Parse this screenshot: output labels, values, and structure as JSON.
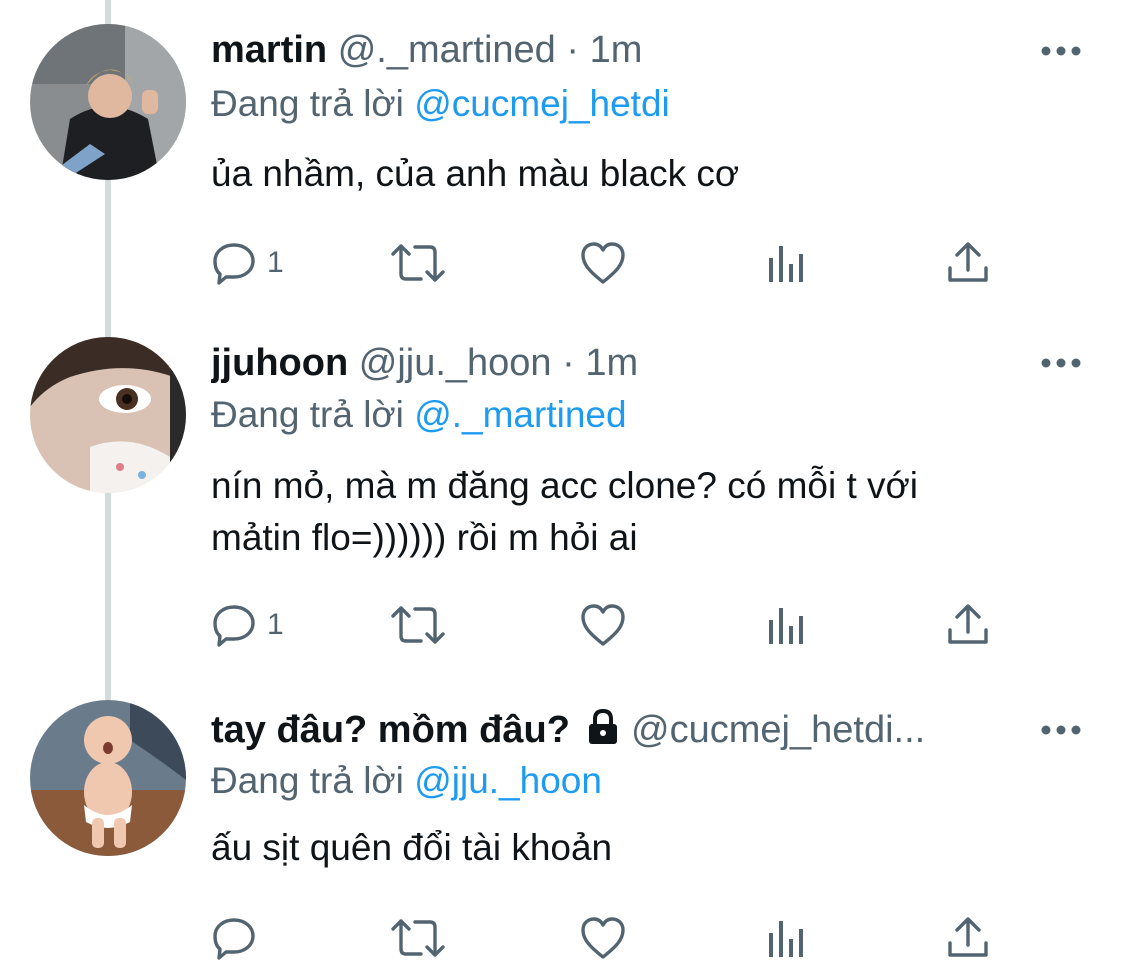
{
  "tweets": [
    {
      "name": "martin",
      "handle": "@._martined",
      "separator": "·",
      "time": "1m",
      "replying_prefix": "Đang trả lời",
      "replying_to": "@cucmej_hetdi",
      "text": "ủa nhầm, của anh màu black cơ",
      "reply_count": "1",
      "locked": false
    },
    {
      "name": "jjuhoon",
      "handle": "@jju._hoon",
      "separator": "·",
      "time": "1m",
      "replying_prefix": "Đang trả lời",
      "replying_to": "@._martined",
      "text_line1": "nín mỏ, mà m đăng acc clone? có mỗi t với",
      "text_line2": "mảtin flo=)))))) rồi m hỏi ai",
      "reply_count": "1",
      "locked": false
    },
    {
      "name": "tay đâu? mồm đâu?",
      "handle": "@cucmej_hetdi...",
      "replying_prefix": "Đang trả lời",
      "replying_to": "@jju._hoon",
      "text": "ấu sịt quên đổi tài khoản",
      "reply_count": "",
      "locked": true
    }
  ],
  "icons": {
    "reply": "speech-bubble",
    "retweet": "retweet-arrows",
    "like": "heart-outline",
    "analytics": "bar-chart",
    "share": "share-upload",
    "more": "three-dots",
    "lock": "padlock"
  },
  "colors": {
    "link": "#1d9bf0",
    "secondary_text": "#536471",
    "primary_text": "#0f1419",
    "thread_line": "#d5dadd"
  }
}
